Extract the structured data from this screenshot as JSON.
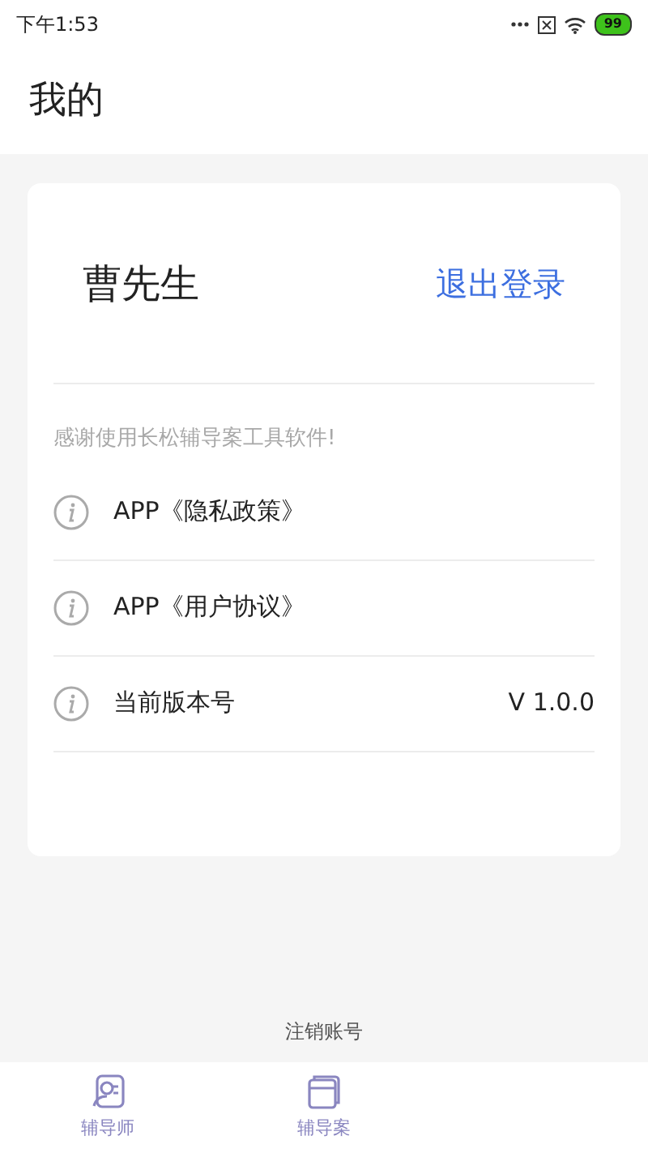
{
  "status_bar": {
    "time": "下午1:53",
    "battery": "99"
  },
  "header": {
    "title": "我的"
  },
  "profile": {
    "name": "曹先生",
    "logout": "退出登录"
  },
  "thanks": "感谢使用长松辅导案工具软件!",
  "rows": [
    {
      "label": "APP《隐私政策》"
    },
    {
      "label": "APP《用户协议》"
    },
    {
      "label": "当前版本号",
      "value": "V 1.0.0"
    }
  ],
  "cancel_account": "注销账号",
  "tab_bar": [
    {
      "kind": "tutor",
      "label": "辅导师"
    },
    {
      "kind": "case",
      "label": "辅导案"
    }
  ]
}
